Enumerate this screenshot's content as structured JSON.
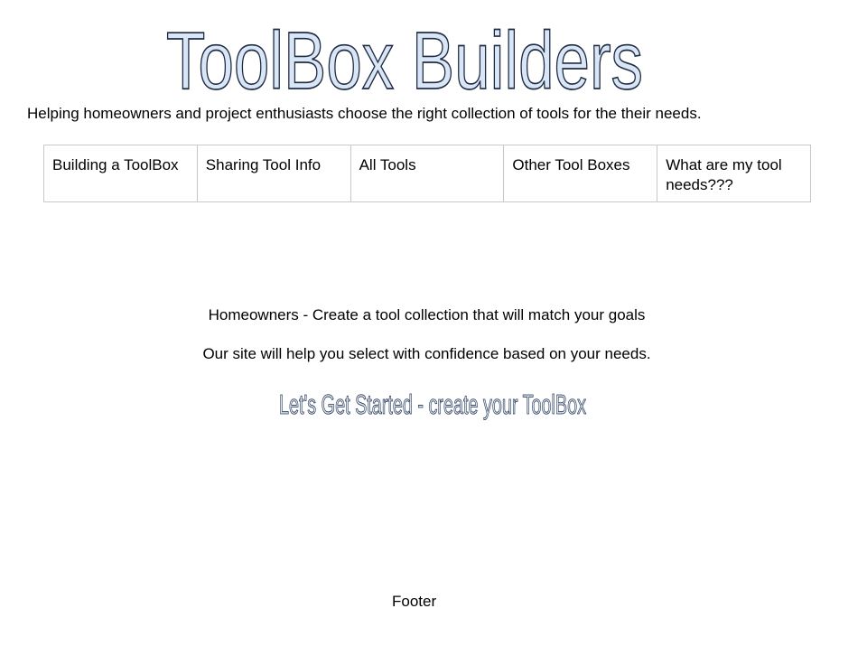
{
  "header": {
    "logo_text": "ToolBox Builders",
    "logo_fill_color": "#d9e6f5",
    "logo_stroke_color": "#1f2a44",
    "tagline": "Helping homeowners and project enthusiasts choose the right collection of tools for the their needs."
  },
  "nav": {
    "items": [
      {
        "label": "Building a ToolBox"
      },
      {
        "label": "Sharing Tool Info"
      },
      {
        "label": "All Tools"
      },
      {
        "label": "Other Tool Boxes"
      },
      {
        "label": "What are my tool needs???"
      }
    ]
  },
  "main": {
    "line1": "Homeowners - Create a tool collection that will match your goals",
    "line2": "Our site will help you select with confidence based on your needs.",
    "cta_text": "Let's Get Started - create your ToolBox"
  },
  "footer": {
    "text": "Footer"
  }
}
